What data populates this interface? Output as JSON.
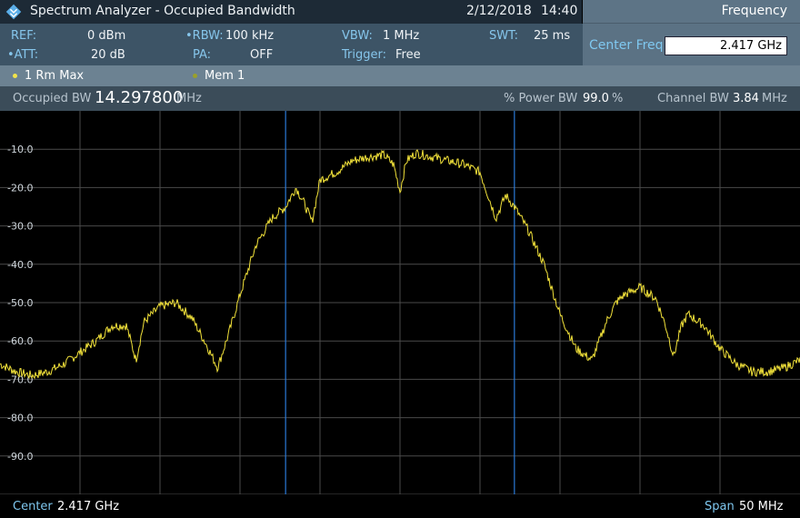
{
  "title": {
    "app": "Spectrum Analyzer - Occupied Bandwidth",
    "date": "2/12/2018",
    "time": "14:40"
  },
  "side_panel": {
    "tab": "Frequency",
    "field_label": "Center Freq",
    "field_value": "2.417 GHz"
  },
  "params": {
    "ref_label": "REF:",
    "ref_value": "0 dBm",
    "att_label": "ATT:",
    "att_value": "20 dB",
    "rbw_label": "RBW:",
    "rbw_value": "100 kHz",
    "pa_label": "PA:",
    "pa_value": "OFF",
    "vbw_label": "VBW:",
    "vbw_value": "1 MHz",
    "trigger_label": "Trigger:",
    "trigger_value": "Free",
    "swt_label": "SWT:",
    "swt_value": "25 ms"
  },
  "traces": {
    "trace1": "1 Rm  Max",
    "trace2": "Mem 1",
    "trace1_color": "#f2e34a",
    "trace2_color": "#9aa02a"
  },
  "results": {
    "obw_label": "Occupied BW",
    "obw_value": "14.297800",
    "obw_unit": "MHz",
    "power_label": "% Power BW",
    "power_value": "99.0",
    "power_unit": "%",
    "chan_label": "Channel BW",
    "chan_value": "3.84",
    "chan_unit": "MHz"
  },
  "chart_data": {
    "type": "line",
    "ylim": [
      -100,
      0
    ],
    "y_ticks": [
      -10,
      -20,
      -30,
      -40,
      -50,
      -60,
      -70,
      -80,
      -90
    ],
    "y_tick_labels": [
      "-10.0",
      "-20.0",
      "-30.0",
      "-40.0",
      "-50.0",
      "-60.0",
      "-70.0",
      "-80.0",
      "-90.0"
    ],
    "xlim": [
      2392,
      2442
    ],
    "x_unit": "MHz",
    "grid": true,
    "trace_color": "#f2e23a",
    "marker_color": "#2a7ad8",
    "markers_x": [
      2409.85,
      2424.15
    ],
    "series": [
      {
        "x": [
          2392.0,
          2393.0,
          2394.0,
          2395.0,
          2396.0,
          2397.0,
          2398.0,
          2399.0,
          2399.9,
          2400.5,
          2401.0,
          2402.0,
          2403.0,
          2404.0,
          2404.9,
          2405.6,
          2406.3,
          2407.0,
          2408.0,
          2409.0,
          2409.85,
          2410.5,
          2411.0,
          2411.5,
          2412.0,
          2413.0,
          2414.0,
          2415.0,
          2416.0,
          2416.6,
          2417.0,
          2417.4,
          2418.0,
          2419.0,
          2420.0,
          2421.0,
          2422.0,
          2422.5,
          2423.0,
          2423.6,
          2424.15,
          2425.0,
          2426.0,
          2427.0,
          2428.0,
          2429.0,
          2429.9,
          2430.5,
          2431.0,
          2432.0,
          2433.0,
          2433.6,
          2434.1,
          2434.6,
          2435.0,
          2436.0,
          2437.0,
          2438.0,
          2439.0,
          2440.0,
          2441.0,
          2442.0
        ],
        "y": [
          -66,
          -68,
          -69,
          -68,
          -66,
          -63,
          -60,
          -56,
          -56,
          -65,
          -55,
          -51,
          -50,
          -54,
          -61,
          -67,
          -58,
          -48,
          -35,
          -28,
          -25,
          -20,
          -24,
          -29,
          -18,
          -16,
          -13,
          -12,
          -11.5,
          -14,
          -21,
          -13,
          -11,
          -12,
          -13,
          -14,
          -16,
          -22,
          -28,
          -22,
          -25,
          -31,
          -40,
          -53,
          -62,
          -65,
          -55,
          -50,
          -48,
          -46,
          -49,
          -56,
          -64,
          -56,
          -53,
          -56,
          -62,
          -66,
          -68,
          -68,
          -67,
          -65
        ]
      }
    ]
  },
  "footer": {
    "center_label": "Center",
    "center_value": "2.417 GHz",
    "span_label": "Span",
    "span_value": "50 MHz"
  }
}
